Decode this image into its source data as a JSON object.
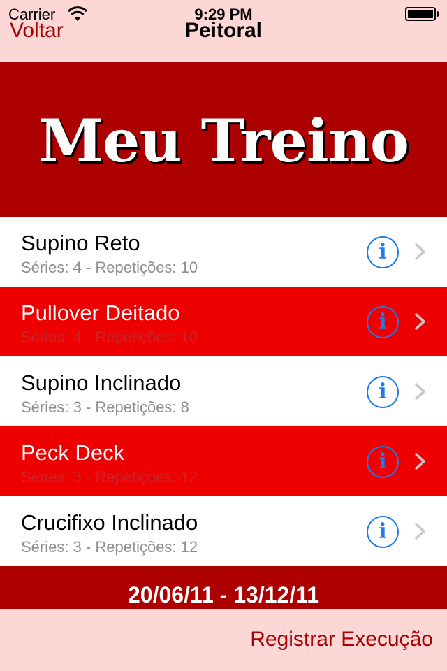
{
  "status_bar": {
    "carrier": "Carrier",
    "time": "9:29 PM",
    "icons": [
      "wifi-icon",
      "battery-icon"
    ]
  },
  "nav": {
    "back_label": "Voltar",
    "title": "Peitoral"
  },
  "banner": {
    "title": "Meu Treino"
  },
  "exercises": [
    {
      "name": "Supino Reto",
      "detail": "Séries: 4 - Repetições: 10",
      "style": "white"
    },
    {
      "name": "Pullover Deitado",
      "detail": "Séries: 4 - Repetições: 10",
      "style": "red"
    },
    {
      "name": "Supino Inclinado",
      "detail": "Séries: 3 - Repetições: 8",
      "style": "white"
    },
    {
      "name": "Peck Deck",
      "detail": "Séries: 3 - Repetições: 12",
      "style": "red"
    },
    {
      "name": "Crucifixo Inclinado",
      "detail": "Séries: 3 - Repetições: 12",
      "style": "white"
    }
  ],
  "info_glyph": "i",
  "date_range": "20/06/11 - 13/12/11",
  "toolbar": {
    "register_label": "Registrar Execução"
  },
  "colors": {
    "nav_bg": "#fdd6d6",
    "accent": "#aa0000",
    "banner_bg": "#ad0000",
    "row_red": "#ee0000",
    "info_blue": "#1b7cf0"
  }
}
